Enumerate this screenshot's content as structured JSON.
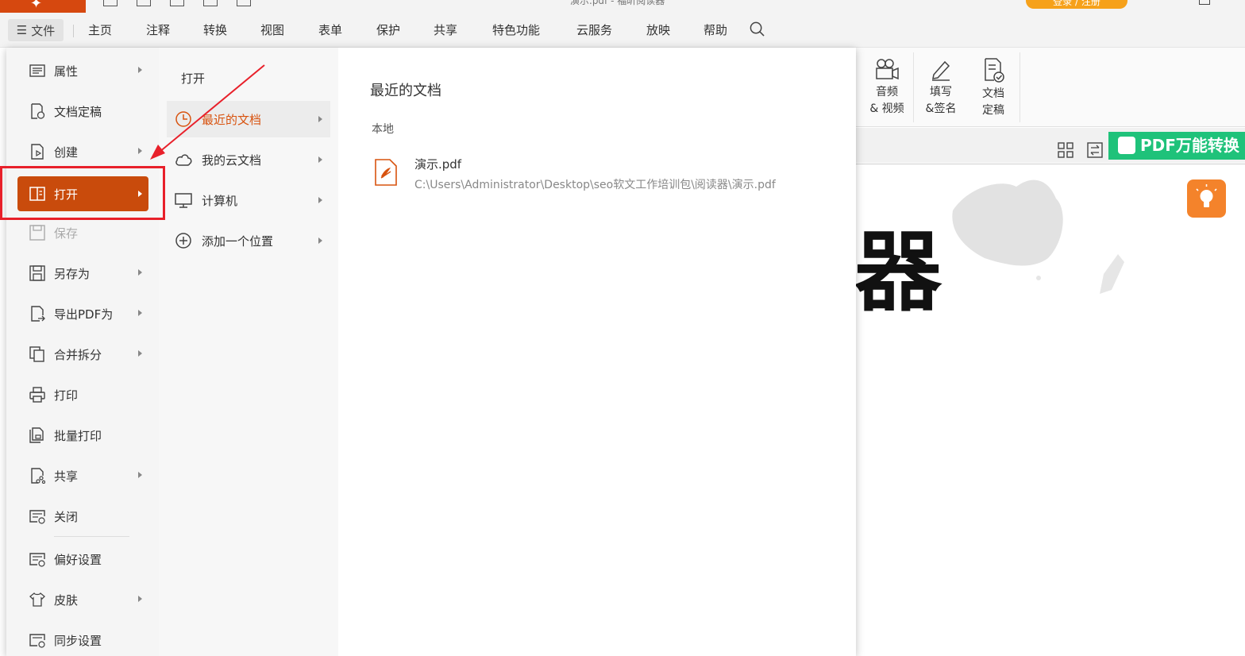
{
  "titlebar": {
    "title_text": "演示.pdf - 福昕阅读器",
    "login_button": "登录 / 注册"
  },
  "menubar": {
    "file_label": "文件",
    "items": [
      "主页",
      "注释",
      "转换",
      "视图",
      "表单",
      "保护",
      "共享",
      "特色功能",
      "云服务",
      "放映",
      "帮助"
    ]
  },
  "ribbon": {
    "buttons": [
      {
        "line1": "音频",
        "line2": "& 视频",
        "icon": "video-icon"
      },
      {
        "line1": "填写",
        "line2": "&签名",
        "icon": "pen-icon"
      },
      {
        "line1": "文档",
        "line2": "定稿",
        "icon": "document-check-icon"
      }
    ]
  },
  "doc": {
    "pdf_badge": "PDF万能转换",
    "big_text": "器"
  },
  "file_menu": {
    "items": [
      {
        "label": "属性",
        "icon": "properties-icon",
        "submenu": true
      },
      {
        "label": "文档定稿",
        "icon": "finalize-icon",
        "submenu": false
      },
      {
        "label": "创建",
        "icon": "create-icon",
        "submenu": true
      },
      {
        "label": "打开",
        "icon": "open-icon",
        "submenu": true,
        "active": true
      },
      {
        "label": "保存",
        "icon": "save-icon",
        "submenu": false,
        "disabled": true
      },
      {
        "label": "另存为",
        "icon": "save-as-icon",
        "submenu": true
      },
      {
        "label": "导出PDF为",
        "icon": "export-icon",
        "submenu": true
      },
      {
        "label": "合并拆分",
        "icon": "merge-split-icon",
        "submenu": true
      },
      {
        "label": "打印",
        "icon": "print-icon",
        "submenu": false
      },
      {
        "label": "批量打印",
        "icon": "batch-print-icon",
        "submenu": false
      },
      {
        "label": "共享",
        "icon": "share-icon",
        "submenu": true
      },
      {
        "label": "关闭",
        "icon": "close-doc-icon",
        "submenu": false
      },
      {
        "label": "偏好设置",
        "icon": "preferences-icon",
        "submenu": false
      },
      {
        "label": "皮肤",
        "icon": "skin-icon",
        "submenu": true
      },
      {
        "label": "同步设置",
        "icon": "sync-settings-icon",
        "submenu": false
      }
    ]
  },
  "open_panel": {
    "title": "打开",
    "items": [
      {
        "label": "最近的文档",
        "icon": "clock-icon",
        "active": true
      },
      {
        "label": "我的云文档",
        "icon": "cloud-icon"
      },
      {
        "label": "计算机",
        "icon": "computer-icon"
      },
      {
        "label": "添加一个位置",
        "icon": "add-location-icon"
      }
    ]
  },
  "recent": {
    "title": "最近的文档",
    "section": "本地",
    "files": [
      {
        "name": "演示.pdf",
        "path": "C:\\Users\\Administrator\\Desktop\\seo软文工作培训包\\阅读器\\演示.pdf"
      }
    ]
  },
  "colors": {
    "accent": "#c94b0c",
    "highlight_box": "#e8202a",
    "pdf_badge": "#1fc27a",
    "login": "#f6a11a"
  }
}
